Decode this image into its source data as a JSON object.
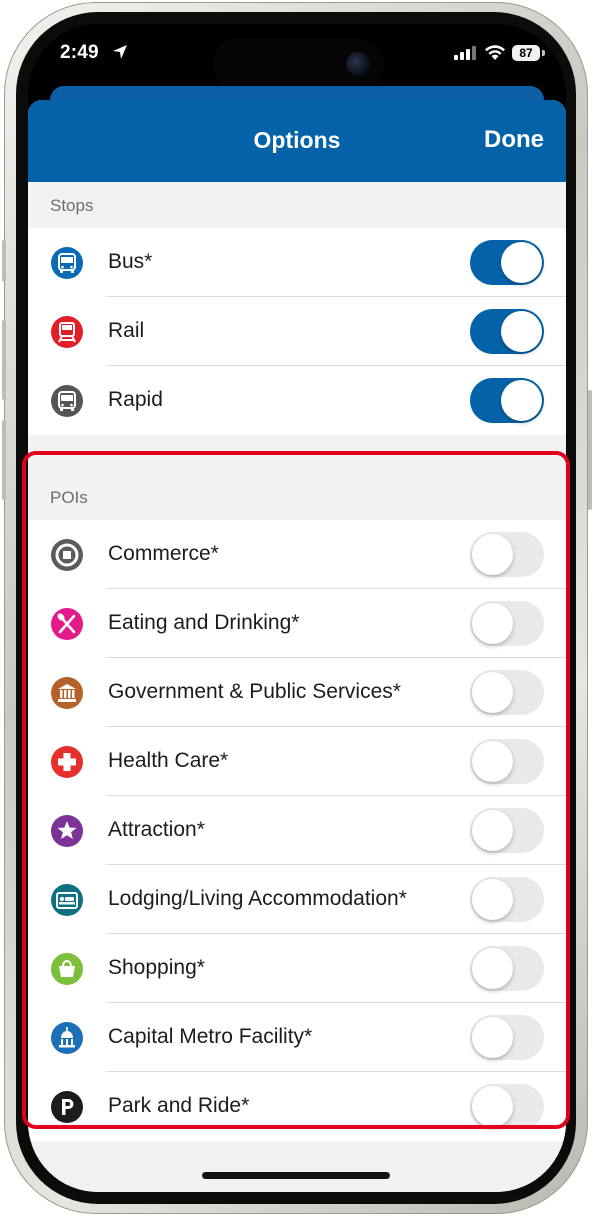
{
  "status": {
    "time": "2:49",
    "battery": "87"
  },
  "nav": {
    "title": "Options",
    "done_label": "Done"
  },
  "sections": [
    {
      "header": "Stops",
      "items": [
        {
          "label": "Bus*",
          "icon": "bus-icon",
          "color": "#0a6ab5",
          "enabled": true
        },
        {
          "label": "Rail",
          "icon": "rail-icon",
          "color": "#e21f26",
          "enabled": true
        },
        {
          "label": "Rapid",
          "icon": "rapid-bus-icon",
          "color": "#555555",
          "enabled": true
        }
      ]
    },
    {
      "header": "POIs",
      "items": [
        {
          "label": "Commerce*",
          "icon": "commerce-icon",
          "color": "#5b5b5b",
          "enabled": false
        },
        {
          "label": "Eating and Drinking*",
          "icon": "fork-knife-icon",
          "color": "#e5198a",
          "enabled": false
        },
        {
          "label": "Government & Public Services*",
          "icon": "government-building-icon",
          "color": "#b4612a",
          "enabled": false
        },
        {
          "label": "Health Care*",
          "icon": "health-cross-icon",
          "color": "#e6302b",
          "enabled": false
        },
        {
          "label": "Attraction*",
          "icon": "star-icon",
          "color": "#7b3397",
          "enabled": false
        },
        {
          "label": "Lodging/Living Accommodation*",
          "icon": "bed-icon",
          "color": "#0e7182",
          "enabled": false
        },
        {
          "label": "Shopping*",
          "icon": "shopping-bag-icon",
          "color": "#7cbf3b",
          "enabled": false
        },
        {
          "label": "Capital Metro Facility*",
          "icon": "capitol-dome-icon",
          "color": "#1d6fb7",
          "enabled": false
        },
        {
          "label": "Park and Ride*",
          "icon": "parking-icon",
          "color": "#1c1c1c",
          "enabled": false
        }
      ]
    }
  ],
  "colors": {
    "nav_blue": "#0463a8",
    "toggle_on": "#0463a8",
    "toggle_off": "#e9e9eb",
    "highlight": "#e0001b"
  }
}
